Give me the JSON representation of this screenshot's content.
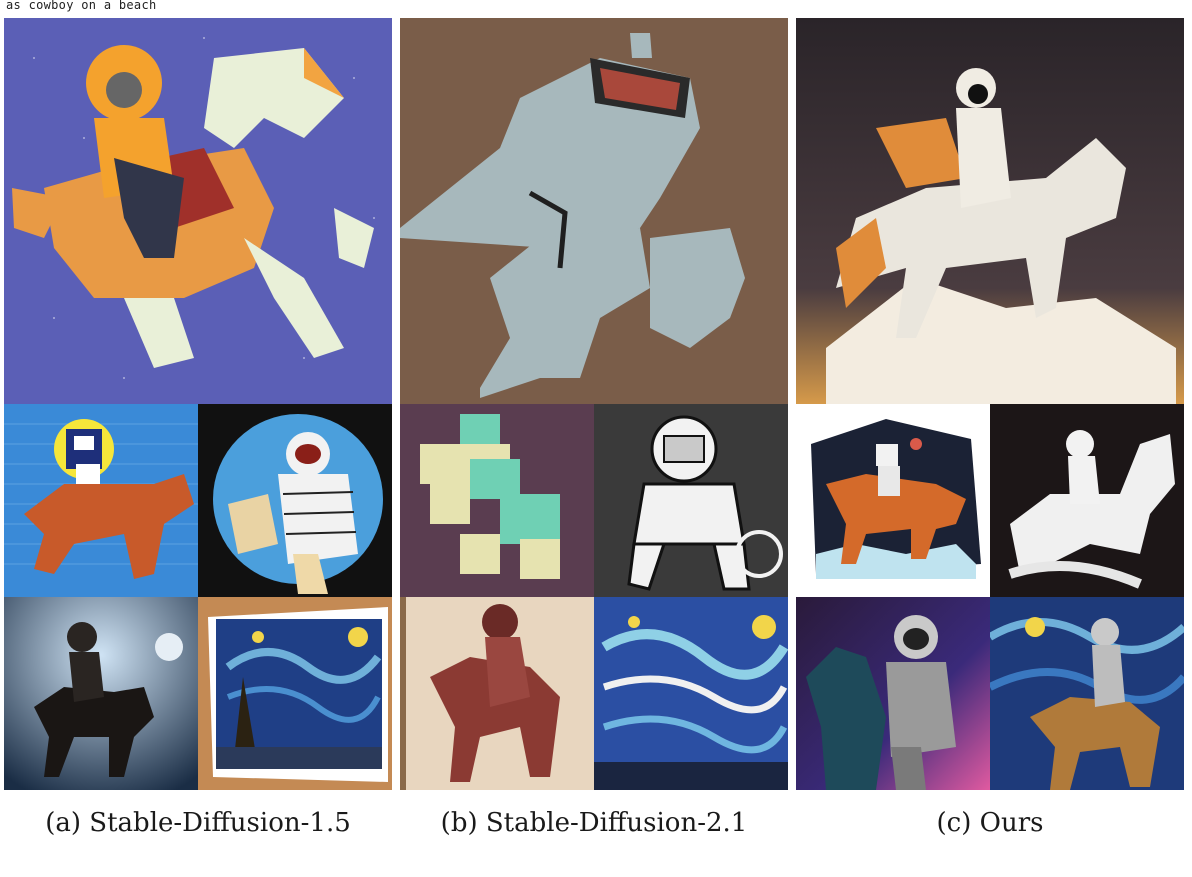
{
  "top_caption": "as cowboy on a beach",
  "captions": {
    "a": "(a) Stable-Diffusion-1.5",
    "b": "(b) Stable-Diffusion-2.1",
    "c": "(c) Ours"
  },
  "colors": {
    "a_big_bg": "#5a5fb5",
    "b_big_bg": "#7a5e4a",
    "c_big_bg": "#3d3538",
    "pixel_bg": "#3e8fd6",
    "night_blue": "#1c3a7a",
    "star_yellow": "#f2d54a"
  }
}
